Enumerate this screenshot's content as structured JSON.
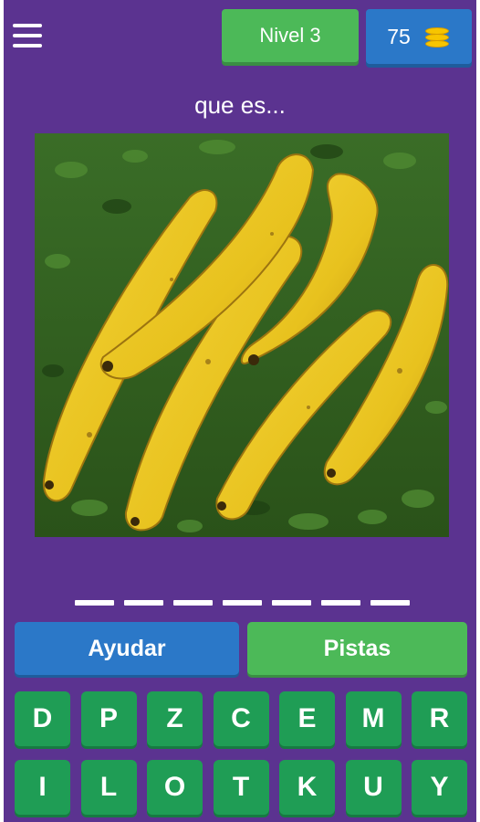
{
  "header": {
    "level_label": "Nivel 3",
    "coins": "75"
  },
  "question": "que es...",
  "image": {
    "subject": "bananas-photo"
  },
  "answer": {
    "letter_count": 7
  },
  "actions": {
    "help_label": "Ayudar",
    "hints_label": "Pistas"
  },
  "keyboard": {
    "row1": [
      "D",
      "P",
      "Z",
      "C",
      "E",
      "M",
      "R"
    ],
    "row2": [
      "I",
      "L",
      "O",
      "T",
      "K",
      "U",
      "Y"
    ]
  },
  "colors": {
    "background": "#5b3390",
    "green": "#4cb958",
    "blue": "#2b78c8",
    "key_green": "#1f9d55",
    "coin": "#f7c500"
  },
  "icons": {
    "menu": "hamburger-menu-icon",
    "coins": "coin-stack-icon"
  }
}
